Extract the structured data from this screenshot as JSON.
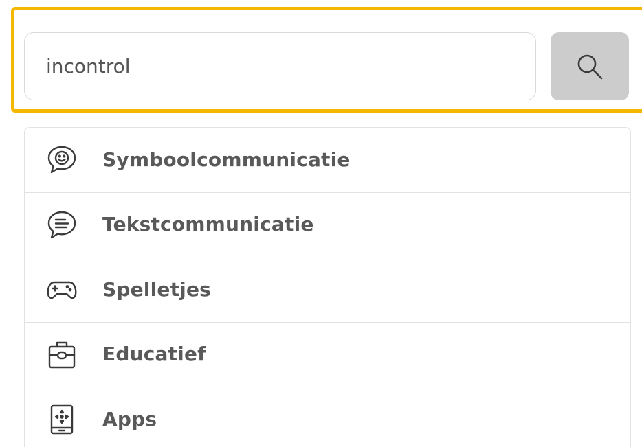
{
  "search": {
    "value": "incontrol",
    "button_icon": "search-icon",
    "highlight_color": "#f5b800"
  },
  "menu": {
    "items": [
      {
        "label": "Symboolcommunicatie",
        "icon": "smiley-speech-bubble-icon"
      },
      {
        "label": "Tekstcommunicatie",
        "icon": "text-speech-bubble-icon"
      },
      {
        "label": "Spelletjes",
        "icon": "gamepad-icon"
      },
      {
        "label": "Educatief",
        "icon": "briefcase-icon"
      },
      {
        "label": "Apps",
        "icon": "tablet-app-icon"
      }
    ]
  }
}
